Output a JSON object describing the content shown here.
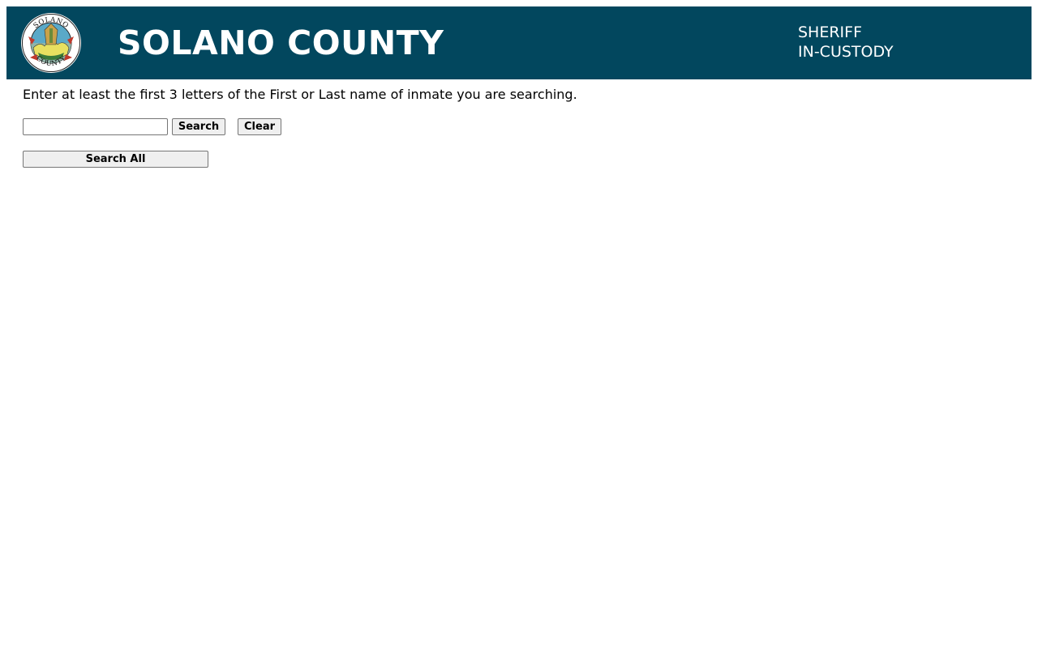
{
  "header": {
    "seal_text_top": "SOLANO",
    "seal_text_bottom": "COUNTY",
    "title": "SOLANO COUNTY",
    "department_line1": "SHERIFF",
    "department_line2": "IN-CUSTODY",
    "background_color": "#02475e"
  },
  "search": {
    "instructions": "Enter at least the first 3 letters of the First or Last name of inmate you are searching.",
    "input_value": "",
    "search_button": "Search",
    "clear_button": "Clear",
    "search_all_button": "Search All"
  }
}
